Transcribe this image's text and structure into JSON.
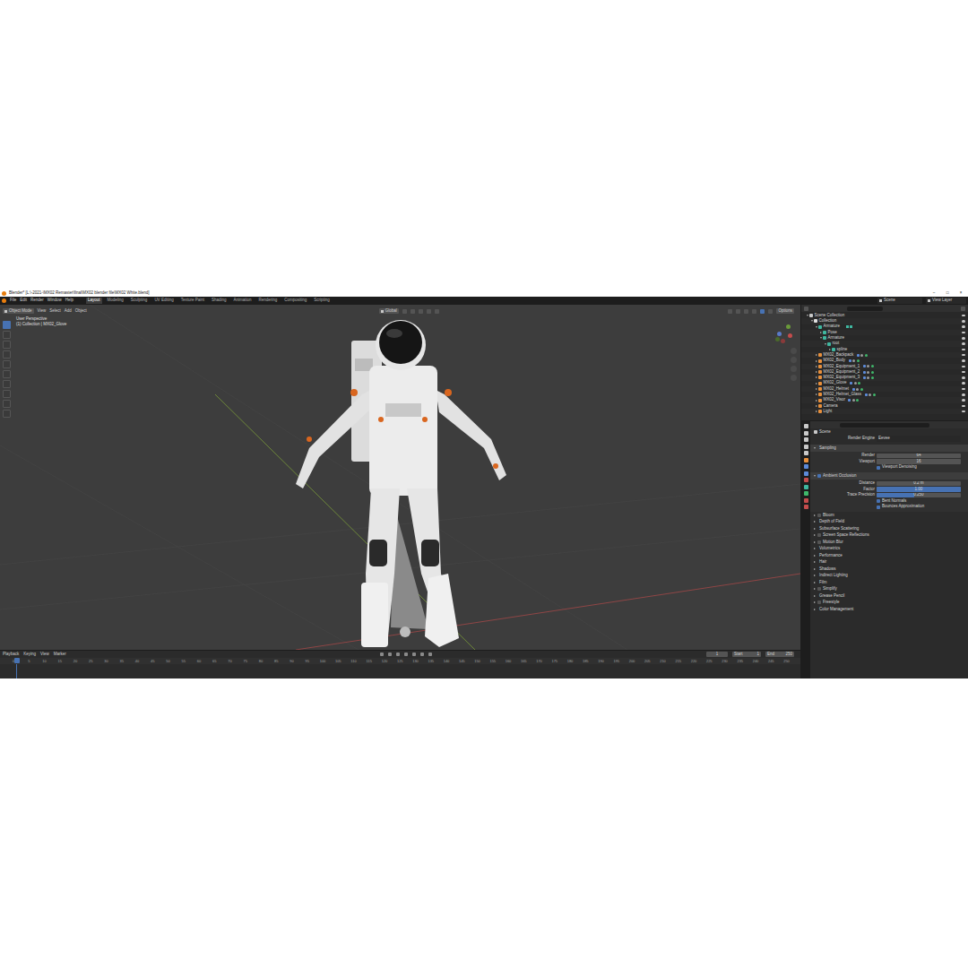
{
  "window": {
    "title": "Blender* [L:\\-2021-\\MX02 Remaster\\final\\MX02 blender file\\MX02 White.blend]",
    "controls": [
      "–",
      "□",
      "×"
    ]
  },
  "menu": [
    "File",
    "Edit",
    "Render",
    "Window",
    "Help"
  ],
  "workspaces": [
    {
      "label": "Layout",
      "selected": true
    },
    {
      "label": "Modeling",
      "selected": false
    },
    {
      "label": "Sculpting",
      "selected": false
    },
    {
      "label": "UV Editing",
      "selected": false
    },
    {
      "label": "Texture Paint",
      "selected": false
    },
    {
      "label": "Shading",
      "selected": false
    },
    {
      "label": "Animation",
      "selected": false
    },
    {
      "label": "Rendering",
      "selected": false
    },
    {
      "label": "Compositing",
      "selected": false
    },
    {
      "label": "Scripting",
      "selected": false
    }
  ],
  "top_right": {
    "scene": "Scene",
    "view_layer": "View Layer"
  },
  "viewport": {
    "mode": "Object Mode",
    "menus": [
      "View",
      "Select",
      "Add",
      "Object"
    ],
    "orientation": "Global",
    "options": "Options",
    "overlay": [
      "User Perspective",
      "(1) Collection | MX02_Glove"
    ]
  },
  "toolbar": {
    "tools": [
      {
        "selected": true
      },
      {
        "selected": false
      },
      {
        "selected": false
      },
      {
        "selected": false
      },
      {
        "selected": false
      },
      {
        "selected": false
      },
      {
        "selected": false
      },
      {
        "selected": false
      },
      {
        "selected": false
      },
      {
        "selected": false
      }
    ]
  },
  "outliner": {
    "items": [
      {
        "label": "Scene Collection",
        "kind": "scene",
        "expanded": true,
        "children": [
          {
            "label": "Collection",
            "kind": "collection",
            "expanded": true,
            "children": [
              {
                "label": "Armature",
                "kind": "armature",
                "expanded": true,
                "children": [
                  {
                    "label": "Pose",
                    "kind": "pose",
                    "expanded": false,
                    "children": []
                  },
                  {
                    "label": "Armature",
                    "kind": "armature",
                    "expanded": true,
                    "children": [
                      {
                        "label": "root",
                        "kind": "bone",
                        "expanded": true,
                        "children": [
                          {
                            "label": "spline",
                            "kind": "bone",
                            "expanded": false,
                            "children": []
                          }
                        ]
                      }
                    ]
                  }
                ]
              },
              {
                "label": "MX02_Backpack",
                "kind": "mesh",
                "expanded": false,
                "children": []
              },
              {
                "label": "MX02_Body",
                "kind": "mesh",
                "expanded": false,
                "children": []
              },
              {
                "label": "MX02_Equipment_1",
                "kind": "mesh",
                "expanded": false,
                "children": []
              },
              {
                "label": "MX02_Equipment_2",
                "kind": "mesh",
                "expanded": false,
                "children": []
              },
              {
                "label": "MX02_Equipment_3",
                "kind": "mesh",
                "expanded": false,
                "children": []
              },
              {
                "label": "MX02_Glove",
                "kind": "mesh",
                "expanded": false,
                "children": []
              },
              {
                "label": "MX02_Helmet",
                "kind": "mesh",
                "expanded": false,
                "children": []
              },
              {
                "label": "MX02_Helmet_Glass",
                "kind": "mesh",
                "expanded": false,
                "children": []
              },
              {
                "label": "MX02_Visor",
                "kind": "mesh",
                "expanded": false,
                "children": []
              },
              {
                "label": "Camera",
                "kind": "camera",
                "expanded": false,
                "children": []
              },
              {
                "label": "Light",
                "kind": "light",
                "expanded": false,
                "children": []
              }
            ]
          }
        ]
      }
    ]
  },
  "properties": {
    "context": "Scene",
    "render_engine": {
      "label": "Render Engine",
      "value": "Eevee"
    },
    "sections": [
      {
        "label": "Sampling",
        "kind": "plain",
        "expanded": true,
        "rows": [
          {
            "kind": "number",
            "label": "Render",
            "value": "64"
          },
          {
            "kind": "number",
            "label": "Viewport",
            "value": "16"
          },
          {
            "kind": "checkbox",
            "label": "Viewport Denoising",
            "checked": true
          }
        ]
      },
      {
        "label": "Ambient Occlusion",
        "kind": "toggle",
        "checked": true,
        "expanded": true,
        "rows": [
          {
            "kind": "number",
            "label": "Distance",
            "value": "0.2 m"
          },
          {
            "kind": "slider",
            "label": "Factor",
            "value": "1.00",
            "level": 1
          },
          {
            "kind": "slider",
            "label": "Trace Precision",
            "value": "0.250",
            "level": 0.45
          },
          {
            "kind": "checkbox",
            "label": "Bent Normals",
            "checked": true
          },
          {
            "kind": "checkbox",
            "label": "Bounces Approximation",
            "checked": true
          }
        ]
      },
      {
        "label": "Bloom",
        "kind": "toggle",
        "checked": false,
        "expanded": false,
        "rows": []
      },
      {
        "label": "Depth of Field",
        "kind": "plain",
        "expanded": false,
        "rows": []
      },
      {
        "label": "Subsurface Scattering",
        "kind": "plain",
        "expanded": false,
        "rows": []
      },
      {
        "label": "Screen Space Reflections",
        "kind": "toggle",
        "checked": false,
        "expanded": false,
        "rows": []
      },
      {
        "label": "Motion Blur",
        "kind": "toggle",
        "checked": false,
        "expanded": false,
        "rows": []
      },
      {
        "label": "Volumetrics",
        "kind": "plain",
        "expanded": false,
        "rows": []
      },
      {
        "label": "Performance",
        "kind": "plain",
        "expanded": false,
        "rows": []
      },
      {
        "label": "Hair",
        "kind": "plain",
        "expanded": false,
        "rows": []
      },
      {
        "label": "Shadows",
        "kind": "plain",
        "expanded": false,
        "rows": []
      },
      {
        "label": "Indirect Lighting",
        "kind": "plain",
        "expanded": false,
        "rows": []
      },
      {
        "label": "Film",
        "kind": "plain",
        "expanded": false,
        "rows": []
      },
      {
        "label": "Simplify",
        "kind": "toggle",
        "checked": false,
        "expanded": false,
        "rows": []
      },
      {
        "label": "Grease Pencil",
        "kind": "plain",
        "expanded": false,
        "rows": []
      },
      {
        "label": "Freestyle",
        "kind": "toggle",
        "checked": false,
        "expanded": false,
        "rows": []
      },
      {
        "label": "Color Management",
        "kind": "plain",
        "expanded": false,
        "rows": []
      }
    ]
  },
  "timeline": {
    "menus": [
      "Playback",
      "Keying",
      "View",
      "Marker"
    ],
    "current": "1",
    "start_label": "Start",
    "start": "1",
    "end_label": "End",
    "end": "250",
    "ticks": [
      "0",
      "5",
      "10",
      "15",
      "20",
      "25",
      "30",
      "35",
      "40",
      "45",
      "50",
      "55",
      "60",
      "65",
      "70",
      "75",
      "80",
      "85",
      "90",
      "95",
      "100",
      "105",
      "110",
      "115",
      "120",
      "125",
      "130",
      "135",
      "140",
      "145",
      "150",
      "155",
      "160",
      "165",
      "170",
      "175",
      "180",
      "185",
      "190",
      "195",
      "200",
      "205",
      "210",
      "215",
      "220",
      "225",
      "230",
      "235",
      "240",
      "245",
      "250"
    ]
  }
}
